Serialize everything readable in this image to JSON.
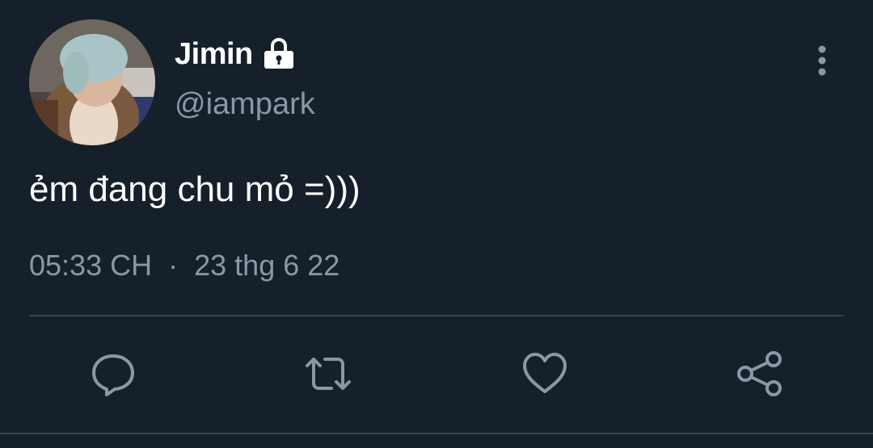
{
  "user": {
    "display_name": "Jimin",
    "handle": "@iampark",
    "avatar_icon": "profile-photo",
    "protected_icon": "lock-icon"
  },
  "tweet": {
    "text": "ẻm đang chu mỏ =)))",
    "time": "05:33 CH",
    "separator": "·",
    "date": "23 thg 6 22"
  },
  "actions": {
    "reply_icon": "comment-icon",
    "retweet_icon": "retweet-icon",
    "like_icon": "heart-icon",
    "share_icon": "share-icon",
    "more_icon": "more-vertical-icon"
  },
  "colors": {
    "background": "#15202b",
    "text_primary": "#ffffff",
    "text_secondary": "#8899a6",
    "divider": "#38444d"
  }
}
